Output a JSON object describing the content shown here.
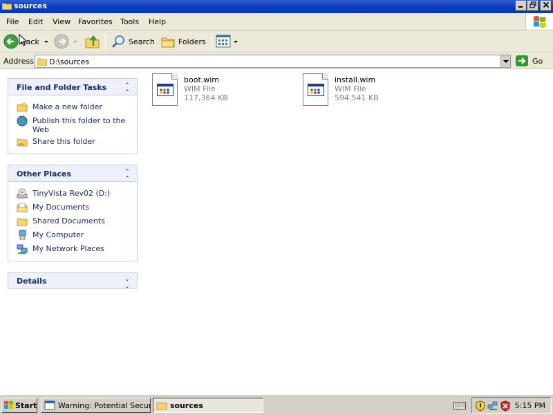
{
  "window": {
    "title": "sources",
    "controls": [
      "minimize",
      "maximize",
      "close"
    ]
  },
  "menubar": {
    "items": [
      "File",
      "Edit",
      "View",
      "Favorites",
      "Tools",
      "Help"
    ]
  },
  "toolbar": {
    "back_label": "Back",
    "search_label": "Search",
    "folders_label": "Folders"
  },
  "address": {
    "label": "Address",
    "value": "D:\\sources",
    "go_label": "Go"
  },
  "left_panel": {
    "file_tasks": {
      "title": "File and Folder Tasks",
      "items": [
        {
          "label": "Make a new folder",
          "icon": "new-folder-icon"
        },
        {
          "label": "Publish this folder to the Web",
          "icon": "globe-icon"
        },
        {
          "label": "Share this folder",
          "icon": "share-folder-icon"
        }
      ]
    },
    "other_places": {
      "title": "Other Places",
      "items": [
        {
          "label": "TinyVista Rev02 (D:)",
          "icon": "cd-drive-icon"
        },
        {
          "label": "My Documents",
          "icon": "my-documents-icon"
        },
        {
          "label": "Shared Documents",
          "icon": "folder-icon"
        },
        {
          "label": "My Computer",
          "icon": "my-computer-icon"
        },
        {
          "label": "My Network Places",
          "icon": "network-places-icon"
        }
      ]
    },
    "details": {
      "title": "Details"
    }
  },
  "files": [
    {
      "name": "boot.wim",
      "type": "WIM File",
      "size": "117,364 KB"
    },
    {
      "name": "install.wim",
      "type": "WIM File",
      "size": "594,541 KB"
    }
  ],
  "taskbar": {
    "start_label": "Start",
    "buttons": [
      {
        "label": "Warning: Potential Secur...",
        "active": false
      },
      {
        "label": "sources",
        "active": true
      }
    ],
    "clock": "5:15 PM"
  }
}
